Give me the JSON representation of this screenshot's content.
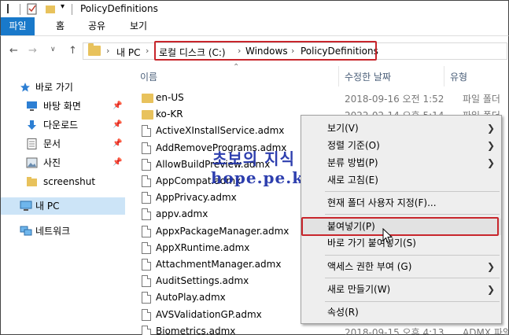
{
  "titlebar": {
    "title": "PolicyDefinitions"
  },
  "ribbon": {
    "tabs": [
      "파일",
      "홈",
      "공유",
      "보기"
    ]
  },
  "address": {
    "root": "내 PC",
    "path": [
      "로컬 디스크 (C:)",
      "Windows",
      "PolicyDefinitions"
    ]
  },
  "sidebar": {
    "items": [
      {
        "label": "바로 가기",
        "icon": "star-icon"
      },
      {
        "label": "바탕 화면",
        "icon": "desktop-icon"
      },
      {
        "label": "다운로드",
        "icon": "download-icon"
      },
      {
        "label": "문서",
        "icon": "documents-icon"
      },
      {
        "label": "사진",
        "icon": "pictures-icon"
      },
      {
        "label": "screenshut",
        "icon": "folder-icon"
      },
      {
        "label": "내 PC",
        "icon": "pc-icon"
      },
      {
        "label": "네트워크",
        "icon": "network-icon"
      }
    ]
  },
  "columns": {
    "name": "이름",
    "modified": "수정한 날짜",
    "type": "유형"
  },
  "files": [
    {
      "name": "en-US",
      "date": "2018-09-16 오전 1:52",
      "type": "파일 폴더",
      "kind": "folder"
    },
    {
      "name": "ko-KR",
      "date": "2022-02-14 오후 5:14",
      "type": "파일 폴더",
      "kind": "folder"
    },
    {
      "name": "ActiveXInstallService.admx",
      "date": "",
      "type": "",
      "kind": "file"
    },
    {
      "name": "AddRemovePrograms.admx",
      "date": "",
      "type": "",
      "kind": "file"
    },
    {
      "name": "AllowBuildPreview.admx",
      "date": "",
      "type": "",
      "kind": "file"
    },
    {
      "name": "AppCompat.admx",
      "date": "",
      "type": "",
      "kind": "file"
    },
    {
      "name": "AppPrivacy.admx",
      "date": "",
      "type": "",
      "kind": "file"
    },
    {
      "name": "appv.admx",
      "date": "",
      "type": "",
      "kind": "file"
    },
    {
      "name": "AppxPackageManager.admx",
      "date": "",
      "type": "",
      "kind": "file"
    },
    {
      "name": "AppXRuntime.admx",
      "date": "",
      "type": "",
      "kind": "file"
    },
    {
      "name": "AttachmentManager.admx",
      "date": "",
      "type": "",
      "kind": "file"
    },
    {
      "name": "AuditSettings.admx",
      "date": "",
      "type": "",
      "kind": "file"
    },
    {
      "name": "AutoPlay.admx",
      "date": "",
      "type": "",
      "kind": "file"
    },
    {
      "name": "AVSValidationGP.admx",
      "date": "",
      "type": "",
      "kind": "file"
    },
    {
      "name": "Biometrics.admx",
      "date": "2018-09-15 오후 4:13",
      "type": "ADMX 파일",
      "kind": "file"
    }
  ],
  "watermark": {
    "line1": "초보의 지식 창고..",
    "line2": "hope.pe.kr"
  },
  "context_menu": {
    "items": [
      {
        "label": "보기(V)",
        "submenu": true
      },
      {
        "label": "정렬 기준(O)",
        "submenu": true
      },
      {
        "label": "분류 방법(P)",
        "submenu": true
      },
      {
        "label": "새로 고침(E)",
        "submenu": false
      },
      {
        "label": "현재 폴더 사용자 지정(F)...",
        "submenu": false
      },
      {
        "label": "붙여넣기(P)",
        "submenu": false
      },
      {
        "label": "바로 가기 붙여넣기(S)",
        "submenu": false
      },
      {
        "label": "액세스 권한 부여 (G)",
        "submenu": true
      },
      {
        "label": "새로 만들기(W)",
        "submenu": true
      },
      {
        "label": "속성(R)",
        "submenu": false
      }
    ]
  },
  "colors": {
    "accent": "#1979ca",
    "highlight_box": "#c8262c",
    "folder": "#e8c25c",
    "watermark": "#1d2fa8"
  }
}
